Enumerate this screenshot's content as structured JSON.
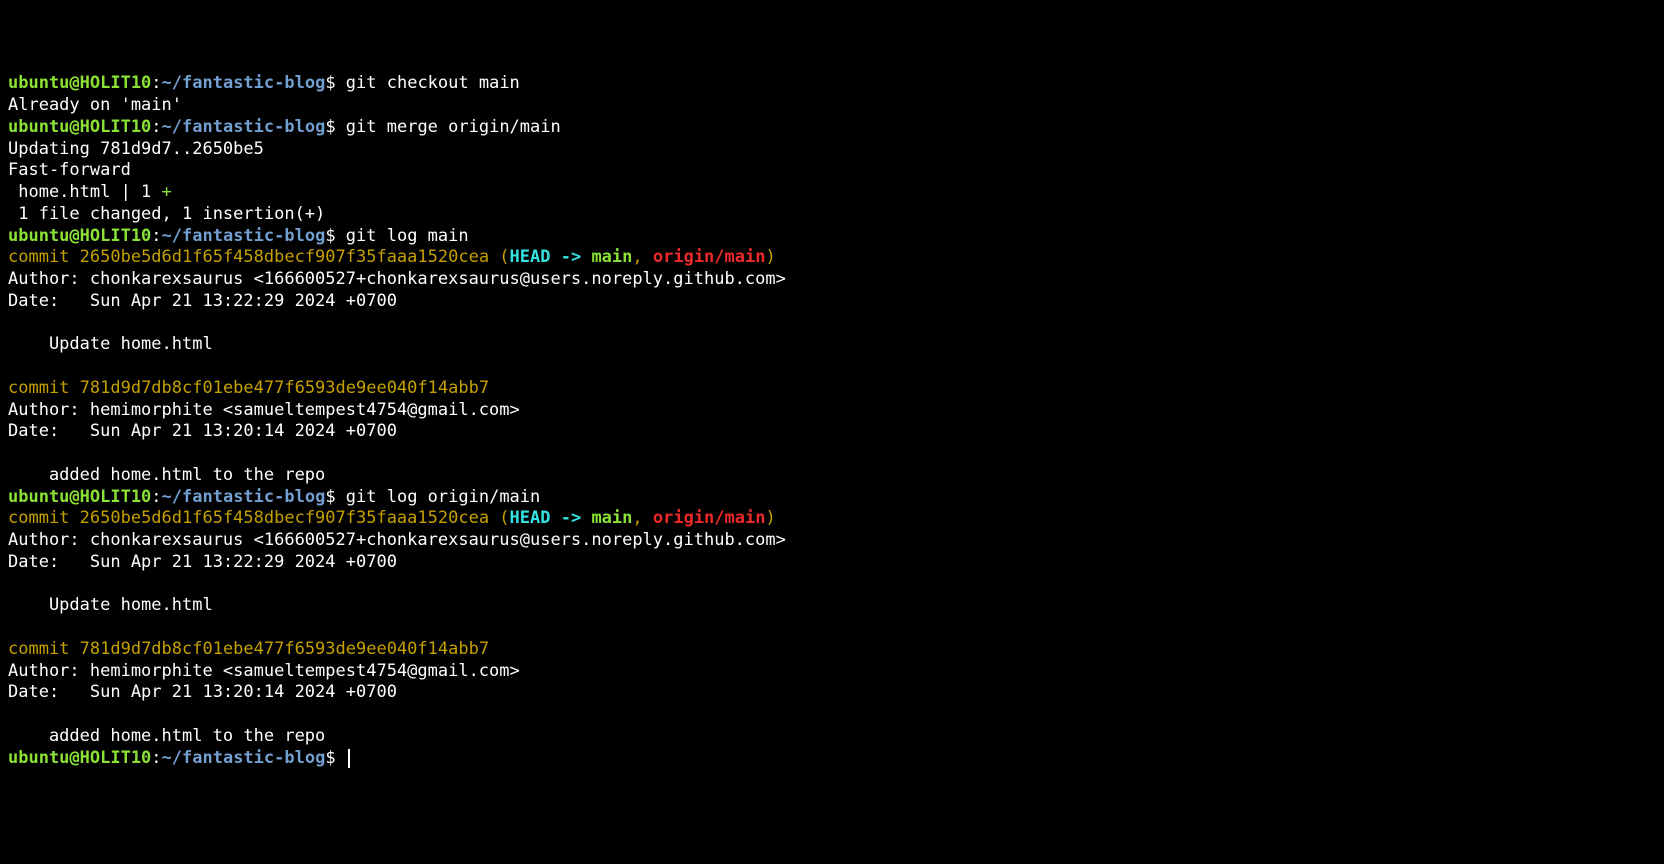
{
  "prompt": {
    "user_host": "ubuntu@HOLIT10",
    "sep1": ":",
    "path": "~/fantastic-blog",
    "dollar": "$ "
  },
  "commands": {
    "checkout": "git checkout main",
    "merge": "git merge origin/main",
    "log_main": "git log main",
    "log_origin": "git log origin/main"
  },
  "output": {
    "already_on_main": "Already on 'main'",
    "updating": "Updating 781d9d7..2650be5",
    "fast_forward": "Fast-forward",
    "diffstat_file": " home.html | 1 ",
    "diffstat_plus": "+",
    "summary": " 1 file changed, 1 insertion(+)"
  },
  "commit1": {
    "label": "commit ",
    "hash": "2650be5d6d1f65f458dbecf907f35faaa1520cea",
    "refs_open": " (",
    "head": "HEAD -> ",
    "main": "main",
    "comma": ", ",
    "origin": "origin/main",
    "refs_close": ")",
    "author": "Author: chonkarexsaurus <166600527+chonkarexsaurus@users.noreply.github.com>",
    "date": "Date:   Sun Apr 21 13:22:29 2024 +0700",
    "message": "    Update home.html"
  },
  "commit2": {
    "label": "commit ",
    "hash": "781d9d7db8cf01ebe477f6593de9ee040f14abb7",
    "author": "Author: hemimorphite <samueltempest4754@gmail.com>",
    "date": "Date:   Sun Apr 21 13:20:14 2024 +0700",
    "message": "    added home.html to the repo"
  }
}
